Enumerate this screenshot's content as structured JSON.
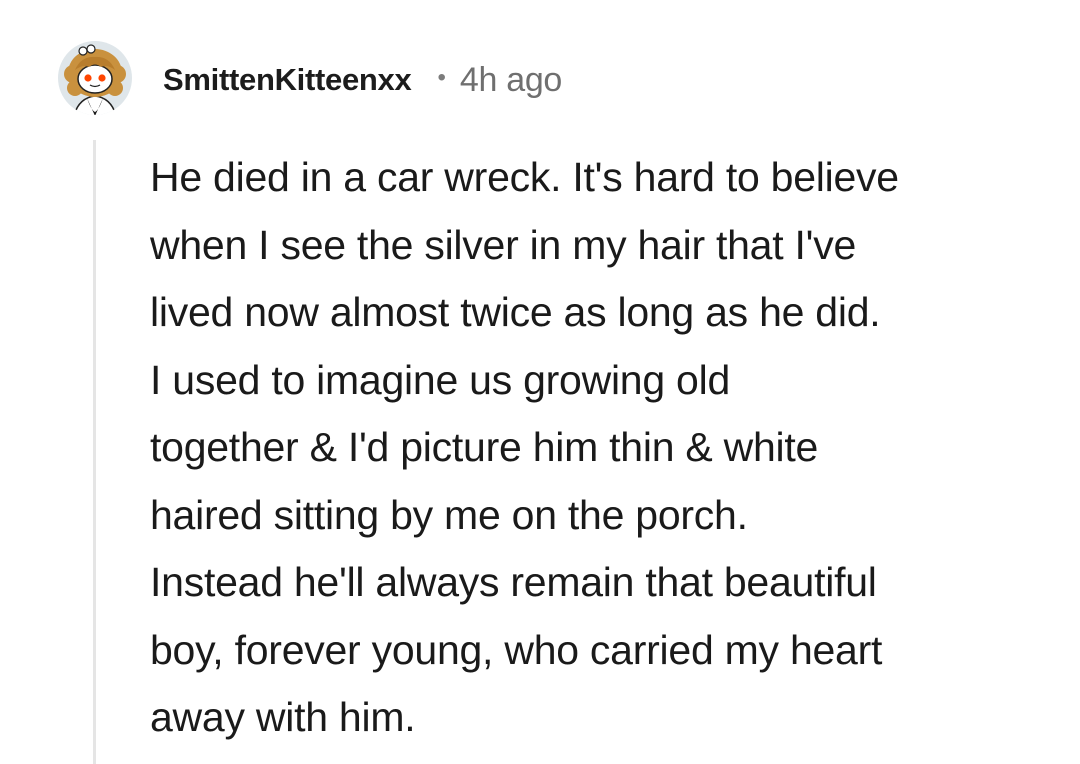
{
  "comment": {
    "author": "SmittenKitteenxx",
    "separator": "•",
    "timestamp": "4h ago",
    "body_lines": [
      "He died in a car wreck. It's hard to believe",
      "when I see the silver in my hair that I've",
      "lived now almost twice as long as he did.",
      "I used to imagine us growing old",
      "together & I'd picture him thin & white",
      "haired sitting by me on the porch.",
      "Instead he'll always remain that beautiful",
      "boy, forever young, who carried my heart",
      "away with him."
    ]
  },
  "avatar": {
    "icon": "snoo-avatar-icon",
    "background": "#dfe6ea",
    "hair_color": "#c9913e",
    "face_color": "#ffffff",
    "eye_color": "#ff4500"
  },
  "colors": {
    "thread_line": "#e5e5e5",
    "text": "#1a1a1a",
    "meta": "#6f6f6f"
  }
}
